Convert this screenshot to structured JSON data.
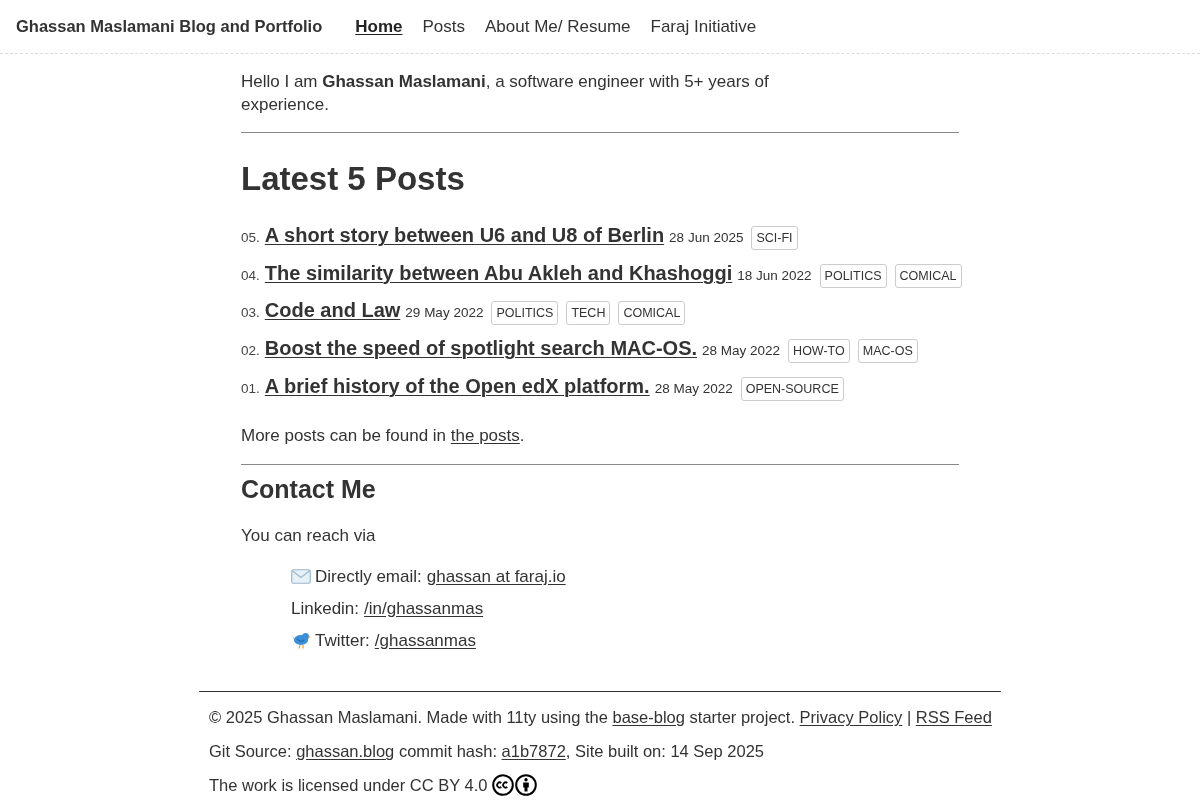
{
  "header": {
    "title": "Ghassan Maslamani Blog and Portfolio",
    "nav": [
      {
        "label": "Home",
        "selected": true
      },
      {
        "label": "Posts",
        "selected": false
      },
      {
        "label": "About Me/ Resume",
        "selected": false
      },
      {
        "label": "Faraj Initiative",
        "selected": false
      }
    ]
  },
  "intro": "Hello I am **Ghassan Maslamani**, a software engineer with 5+ years of experience.",
  "latest": {
    "heading": "Latest 5 Posts",
    "posts": [
      {
        "number": "05.",
        "title": "A short story between U6 and U8 of Berlin",
        "date": "28 Jun 2025",
        "tags": [
          "SCI-FI"
        ]
      },
      {
        "number": "04.",
        "title": "The similarity between Abu Akleh and Khashoggi",
        "date": "18 Jun 2022",
        "tags": [
          "POLITICS",
          "COMICAL"
        ]
      },
      {
        "number": "03.",
        "title": "Code and Law",
        "date": "29 May 2022",
        "tags": [
          "POLITICS",
          "TECH",
          "COMICAL"
        ]
      },
      {
        "number": "02.",
        "title": "Boost the speed of spotlight search MAC-OS.",
        "date": "28 May 2022",
        "tags": [
          "HOW-TO",
          "MAC-OS"
        ]
      },
      {
        "number": "01.",
        "title": "A brief history of the Open edX platform.",
        "date": "28 May 2022",
        "tags": [
          "OPEN-SOURCE"
        ]
      }
    ],
    "more": {
      "text": "More posts can be found in",
      "link": "the posts",
      "after": "."
    }
  },
  "contact": {
    "heading": "Contact Me",
    "intro": "You can reach via",
    "items": [
      {
        "kind": "email",
        "label": "Directly email:",
        "link": "ghassan at faraj.io"
      },
      {
        "kind": "linkedin",
        "label": "Linkedin:",
        "link": "/in/ghassanmas"
      },
      {
        "kind": "twitter",
        "label": "Twitter:",
        "link": "/ghassanmas"
      }
    ]
  },
  "footer": {
    "lines": [
      [
        {
          "kind": "text",
          "text": "© 2025 Ghassan Maslamani. Made with 11ty using the "
        },
        {
          "kind": "link",
          "text": "base-blog"
        },
        {
          "kind": "text",
          "text": " starter project. "
        },
        {
          "kind": "link",
          "text": "Privacy Policy"
        },
        {
          "kind": "text",
          "text": " | "
        },
        {
          "kind": "link",
          "text": "RSS Feed"
        }
      ],
      [
        {
          "kind": "text",
          "text": "Git Source: "
        },
        {
          "kind": "link",
          "text": "ghassan.blog"
        },
        {
          "kind": "text",
          "text": " commit hash: "
        },
        {
          "kind": "link",
          "text": "a1b7872"
        },
        {
          "kind": "text",
          "text": ", Site built on: 14 Sep 2025"
        }
      ]
    ],
    "license": "The work is licensed under CC BY 4.0"
  }
}
